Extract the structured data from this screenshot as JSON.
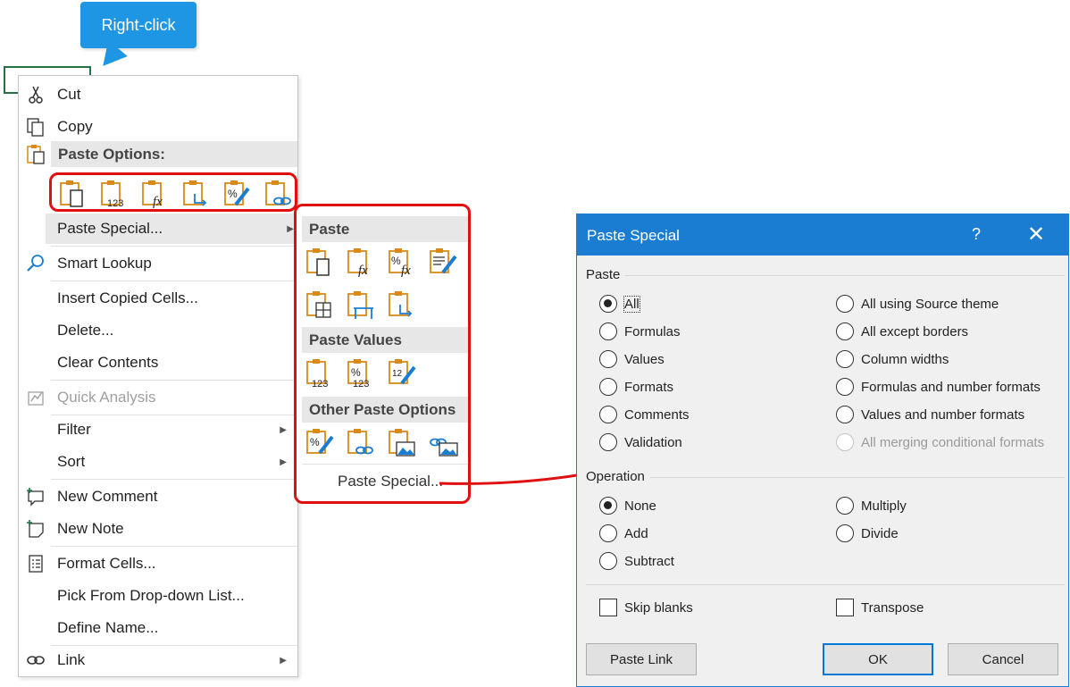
{
  "callout": {
    "text": "Right-click"
  },
  "context_menu": {
    "cut": "Cut",
    "copy": "Copy",
    "paste_options": "Paste Options:",
    "paste_special": "Paste Special...",
    "smart_lookup": "Smart Lookup",
    "insert_copied_cells": "Insert Copied Cells...",
    "delete": "Delete...",
    "clear_contents": "Clear Contents",
    "quick_analysis": "Quick Analysis",
    "filter": "Filter",
    "sort": "Sort",
    "new_comment": "New Comment",
    "new_note": "New Note",
    "format_cells": "Format Cells...",
    "pick_from_list": "Pick From Drop-down List...",
    "define_name": "Define Name...",
    "link": "Link"
  },
  "submenu": {
    "paste_header": "Paste",
    "paste_values_header": "Paste Values",
    "other_header": "Other Paste Options",
    "paste_special_link": "Paste Special..."
  },
  "dialog": {
    "title": "Paste Special",
    "help": "?",
    "close": "✕",
    "paste_group": "Paste",
    "paste_left": [
      "All",
      "Formulas",
      "Values",
      "Formats",
      "Comments",
      "Validation"
    ],
    "paste_right": [
      "All using Source theme",
      "All except borders",
      "Column widths",
      "Formulas and number formats",
      "Values and number formats",
      "All merging conditional formats"
    ],
    "operation_group": "Operation",
    "op_left": [
      "None",
      "Add",
      "Subtract"
    ],
    "op_right": [
      "Multiply",
      "Divide"
    ],
    "skip_blanks": "Skip blanks",
    "transpose": "Transpose",
    "paste_link_button": "Paste Link",
    "ok_button": "OK",
    "cancel_button": "Cancel"
  },
  "colors": {
    "accent": "#1b7dd1",
    "highlight_red": "#e01010",
    "clipboard_orange": "#d98a1a",
    "callout_blue": "#1e96e3"
  }
}
